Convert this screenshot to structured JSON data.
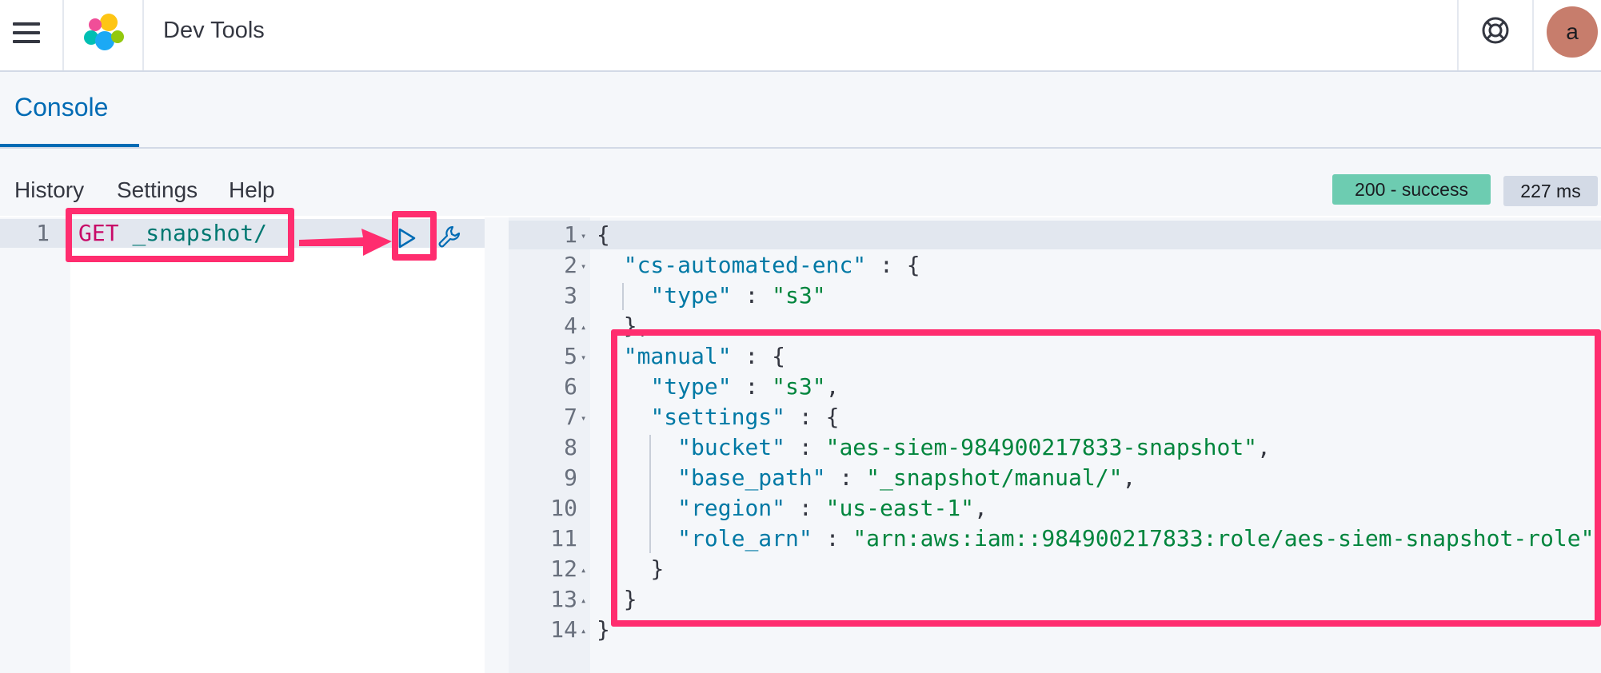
{
  "header": {
    "app_title": "Dev Tools",
    "menu_icon": "hamburger-menu-icon",
    "logo_icon": "kibana-logo-icon",
    "help_icon": "lifebuoy-help-icon",
    "avatar_initial": "a",
    "avatar_color": "#c77d6c"
  },
  "tabs": [
    {
      "label": "Console",
      "active": true
    }
  ],
  "toolbar": {
    "links": [
      "History",
      "Settings",
      "Help"
    ],
    "status_badge": "200 - success",
    "time_badge": "227 ms",
    "status_color": "#6dccb1"
  },
  "request_editor": {
    "line_number": "1",
    "method": "GET",
    "url": "_snapshot/",
    "run_icon": "play-icon",
    "wrench_icon": "wrench-icon"
  },
  "response_editor": {
    "lines": [
      {
        "n": "1",
        "fold": "open"
      },
      {
        "n": "2",
        "fold": "open"
      },
      {
        "n": "3",
        "fold": ""
      },
      {
        "n": "4",
        "fold": "close"
      },
      {
        "n": "5",
        "fold": "open"
      },
      {
        "n": "6",
        "fold": ""
      },
      {
        "n": "7",
        "fold": "open"
      },
      {
        "n": "8",
        "fold": ""
      },
      {
        "n": "9",
        "fold": ""
      },
      {
        "n": "10",
        "fold": ""
      },
      {
        "n": "11",
        "fold": ""
      },
      {
        "n": "12",
        "fold": "close"
      },
      {
        "n": "13",
        "fold": "close"
      },
      {
        "n": "14",
        "fold": "close"
      }
    ],
    "text": {
      "l1_brace": "{",
      "k_cs": "\"cs-automated-enc\"",
      "sep": " : ",
      "open_brace": "{",
      "k_type": "\"type\"",
      "v_s3": "\"s3\"",
      "comma": ",",
      "close_brace": "}",
      "k_manual": "\"manual\"",
      "k_settings": "\"settings\"",
      "k_bucket": "\"bucket\"",
      "v_bucket": "\"aes-siem-984900217833-snapshot\"",
      "k_base_path": "\"base_path\"",
      "v_base_path": "\"_snapshot/manual/\"",
      "k_region": "\"region\"",
      "v_region": "\"us-east-1\"",
      "k_role_arn": "\"role_arn\"",
      "v_role_arn": "\"arn:aws:iam::984900217833:role/aes-siem-snapshot-role\""
    }
  },
  "annotation_color": "#ff2d6f"
}
